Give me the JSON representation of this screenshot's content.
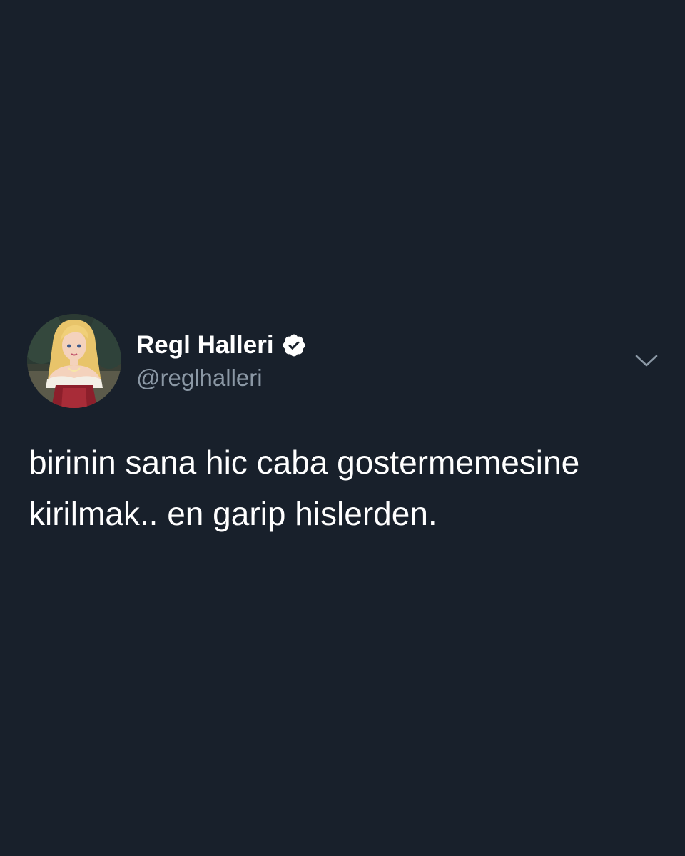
{
  "tweet": {
    "author": {
      "display_name": "Regl Halleri",
      "handle": "@reglhalleri",
      "verified": true
    },
    "text_lines": [
      "birinin sana hic caba gostermemesine",
      "kirilmak.. en garip hislerden."
    ],
    "menu_icon": "chevron-down-icon"
  },
  "colors": {
    "background": "#18202b",
    "primary_text": "#ffffff",
    "secondary_text": "#8b98a5",
    "icon": "#8b98a5",
    "verified_badge": "#ffffff"
  }
}
